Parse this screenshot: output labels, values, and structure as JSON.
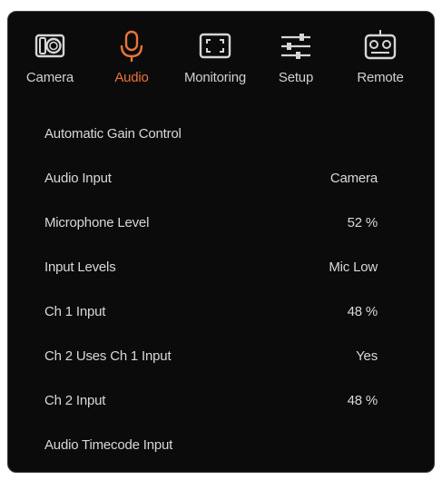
{
  "tabs": [
    {
      "label": "Camera",
      "icon": "camera-icon"
    },
    {
      "label": "Audio",
      "icon": "microphone-icon",
      "active": true
    },
    {
      "label": "Monitoring",
      "icon": "monitoring-icon"
    },
    {
      "label": "Setup",
      "icon": "sliders-icon"
    },
    {
      "label": "Remote",
      "icon": "remote-icon"
    }
  ],
  "menu": {
    "rows": [
      {
        "label": "Automatic Gain Control",
        "value": ""
      },
      {
        "label": "Audio Input",
        "value": "Camera"
      },
      {
        "label": "Microphone Level",
        "value": "52 %"
      },
      {
        "label": "Input Levels",
        "value": "Mic Low"
      },
      {
        "label": "Ch 1 Input",
        "value": "48 %"
      },
      {
        "label": "Ch 2 Uses Ch 1 Input",
        "value": "Yes"
      },
      {
        "label": "Ch 2 Input",
        "value": "48 %"
      },
      {
        "label": "Audio Timecode Input",
        "value": ""
      }
    ]
  },
  "colors": {
    "background": "#0b0b0b",
    "active_tab": "#e8743b",
    "text": "#d8d8d8"
  }
}
